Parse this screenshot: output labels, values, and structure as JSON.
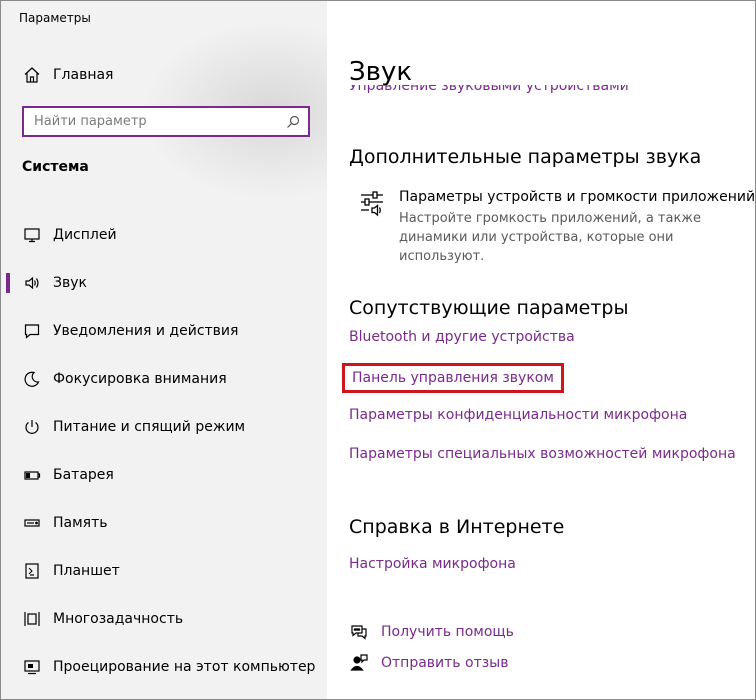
{
  "window": {
    "title": "Параметры"
  },
  "sidebar": {
    "home_label": "Главная",
    "search_placeholder": "Найти параметр",
    "section_title": "Система",
    "items": [
      {
        "label": "Дисплей",
        "icon": "monitor-icon",
        "active": false
      },
      {
        "label": "Звук",
        "icon": "speaker-icon",
        "active": true
      },
      {
        "label": "Уведомления и действия",
        "icon": "notification-icon",
        "active": false
      },
      {
        "label": "Фокусировка внимания",
        "icon": "moon-icon",
        "active": false
      },
      {
        "label": "Питание и спящий режим",
        "icon": "power-icon",
        "active": false
      },
      {
        "label": "Батарея",
        "icon": "battery-icon",
        "active": false
      },
      {
        "label": "Память",
        "icon": "storage-icon",
        "active": false
      },
      {
        "label": "Планшет",
        "icon": "tablet-icon",
        "active": false
      },
      {
        "label": "Многозадачность",
        "icon": "multitasking-icon",
        "active": false
      },
      {
        "label": "Проецирование на этот компьютер",
        "icon": "projection-icon",
        "active": false
      }
    ]
  },
  "main": {
    "title": "Звук",
    "clipped_link": "Управление звуковыми устройствами",
    "advanced": {
      "heading": "Дополнительные параметры звука",
      "item_title": "Параметры устройств и громкости приложений",
      "item_desc": "Настройте громкость приложений, а также динамики или устройства, которые они используют.",
      "item_icon": "mixer-icon"
    },
    "related": {
      "heading": "Сопутствующие параметры",
      "links": [
        "Bluetooth и другие устройства",
        "Панель управления звуком",
        "Параметры конфиденциальности микрофона",
        "Параметры специальных возможностей микрофона"
      ]
    },
    "help": {
      "heading": "Справка в Интернете",
      "link": "Настройка микрофона"
    },
    "footer": {
      "get_help": "Получить помощь",
      "feedback": "Отправить отзыв"
    }
  },
  "colors": {
    "accent": "#7a2a8c",
    "highlight": "#d0141c"
  }
}
